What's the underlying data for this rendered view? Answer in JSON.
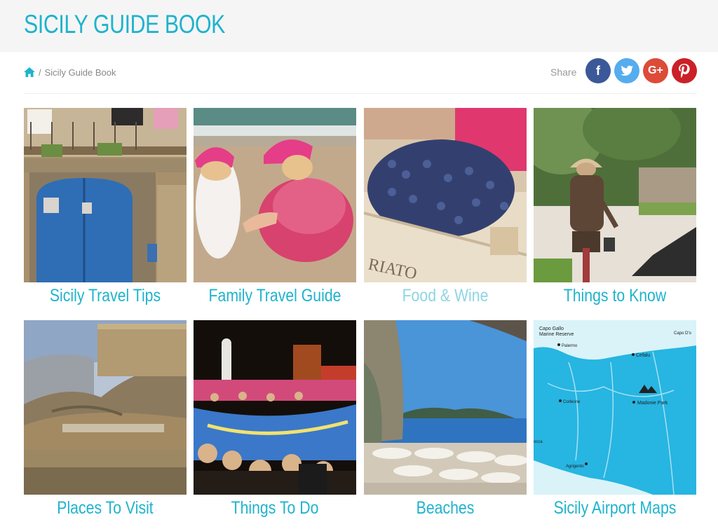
{
  "header": {
    "title": "SICILY GUIDE BOOK"
  },
  "breadcrumb": {
    "separator": "/",
    "current": "Sicily Guide Book",
    "home_icon": "home-icon"
  },
  "share": {
    "label": "Share",
    "buttons": [
      {
        "name": "facebook",
        "glyph": "f",
        "color": "#3b5998"
      },
      {
        "name": "twitter",
        "glyph": "t",
        "color": "#55acee"
      },
      {
        "name": "google-plus",
        "glyph": "G+",
        "color": "#dd4b39"
      },
      {
        "name": "pinterest",
        "glyph": "P",
        "color": "#cb2027"
      }
    ]
  },
  "tiles": [
    {
      "label": "Sicily Travel Tips"
    },
    {
      "label": "Family Travel Guide"
    },
    {
      "label": "Food & Wine"
    },
    {
      "label": "Things to Know"
    },
    {
      "label": "Places To Visit"
    },
    {
      "label": "Things To Do"
    },
    {
      "label": "Beaches"
    },
    {
      "label": "Sicily Airport Maps"
    }
  ],
  "map": {
    "places": [
      "Capo Gallo",
      "Marine Reserve",
      "Palermo",
      "Cefalu",
      "Capo D'o",
      "Corleone",
      "Madonie Park",
      "Agrigento",
      "occa"
    ]
  },
  "colors": {
    "accent": "#1fb3cd",
    "accent_light": "#8fd5e3",
    "header_bg": "#f5f5f5"
  }
}
